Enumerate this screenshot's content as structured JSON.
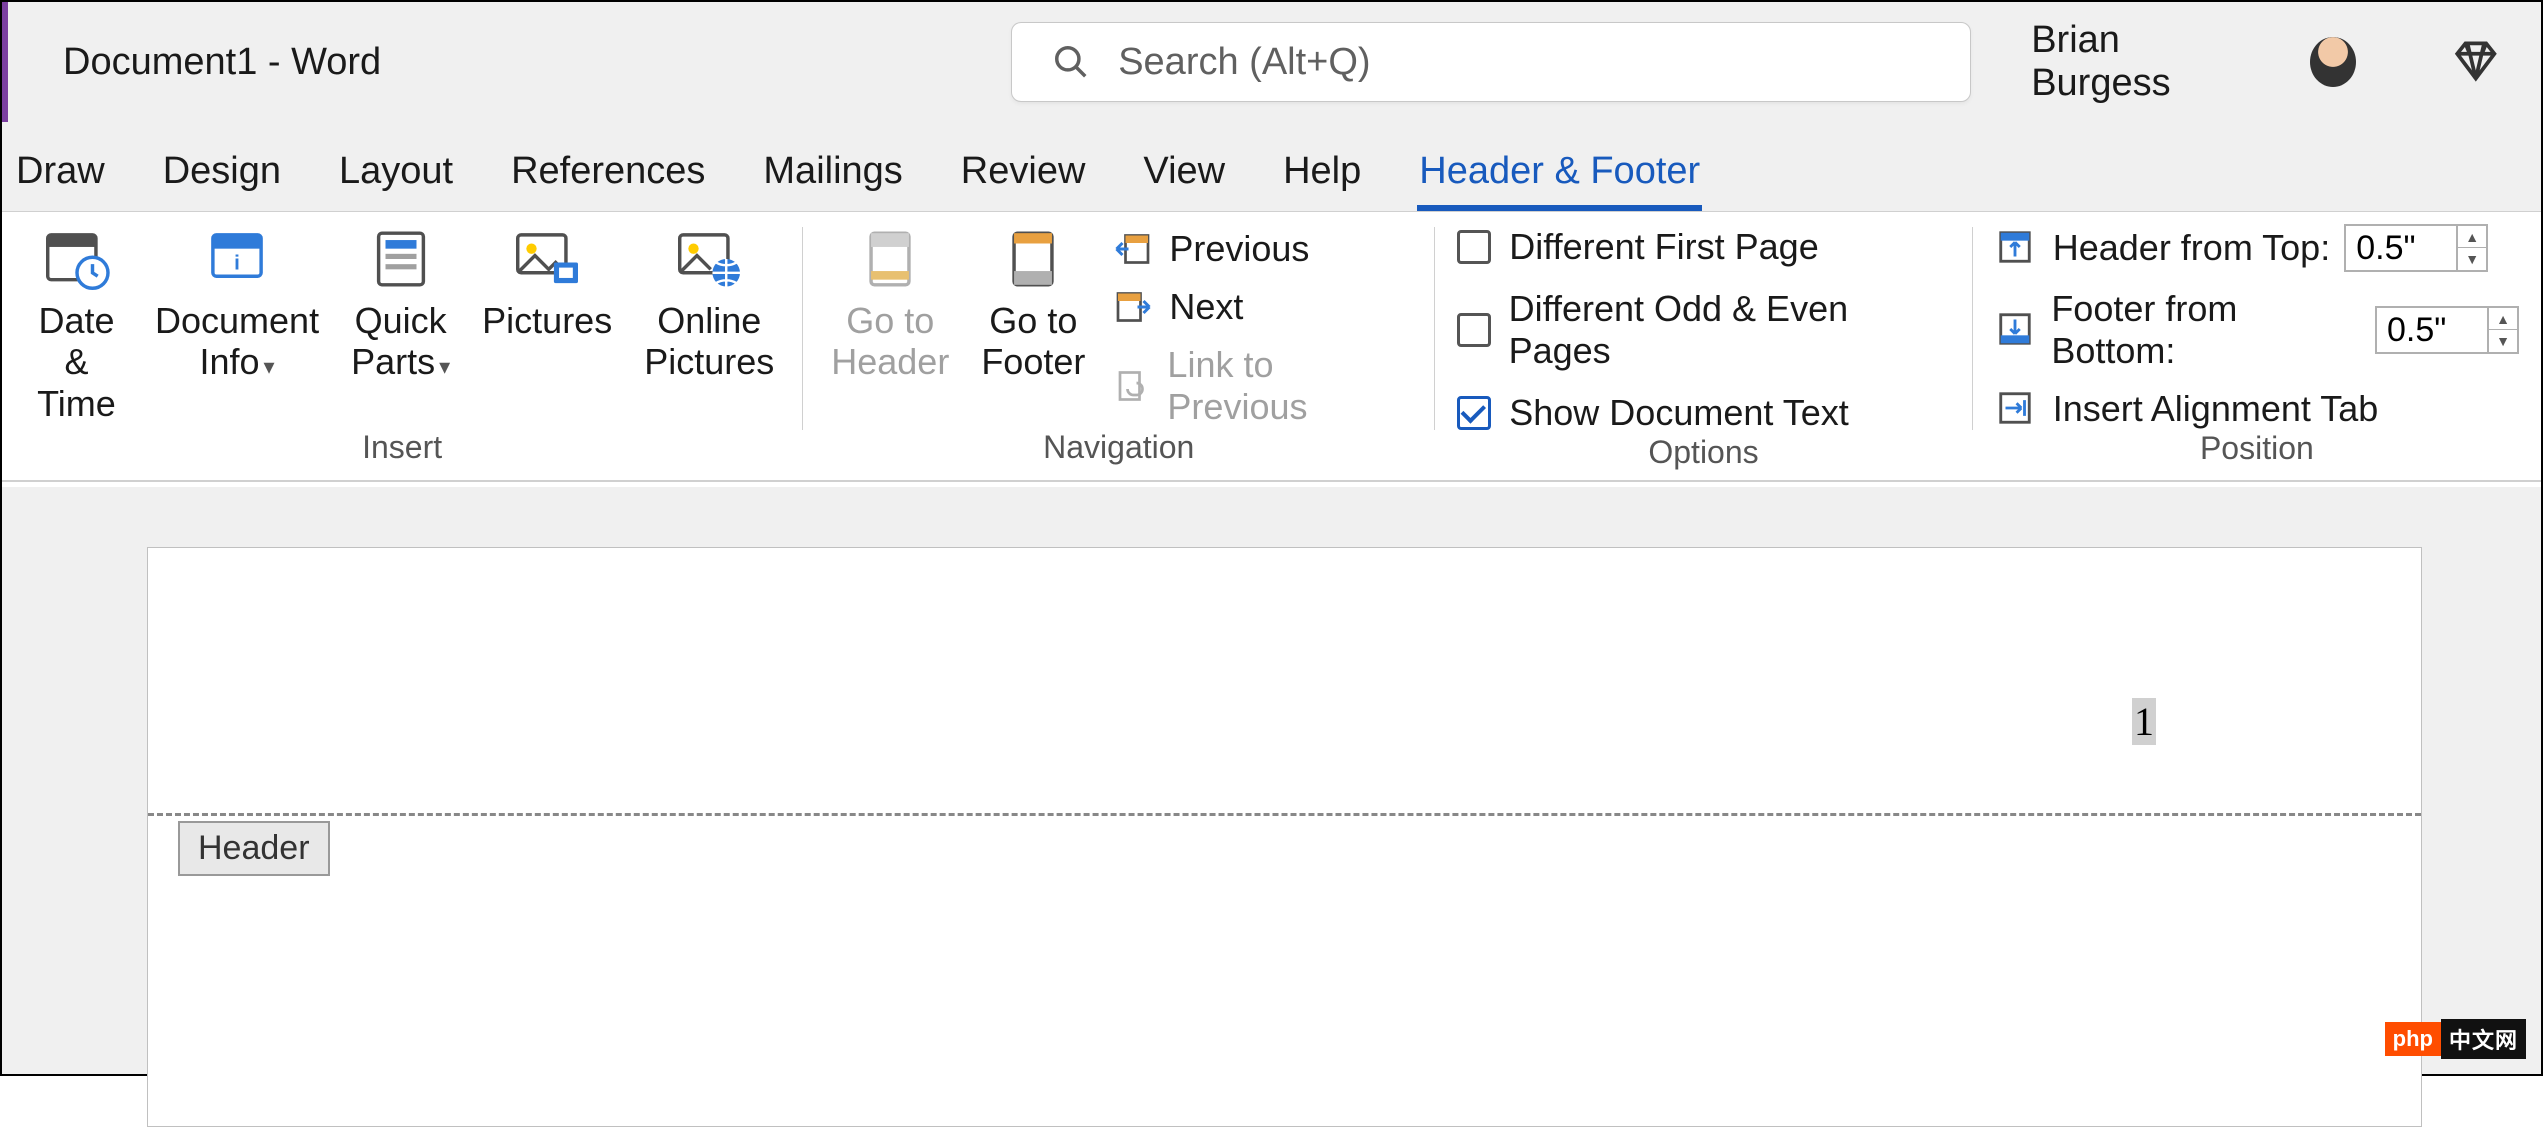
{
  "title": "Document1  -  Word",
  "search": {
    "placeholder": "Search (Alt+Q)"
  },
  "user": {
    "name": "Brian Burgess"
  },
  "tabs": [
    "Draw",
    "Design",
    "Layout",
    "References",
    "Mailings",
    "Review",
    "View",
    "Help",
    "Header & Footer"
  ],
  "active_tab": "Header & Footer",
  "ribbon": {
    "insert": {
      "label": "Insert",
      "date_time": "Date &\nTime",
      "doc_info": "Document\nInfo",
      "quick_parts": "Quick\nParts",
      "pictures": "Pictures",
      "online_pictures": "Online\nPictures"
    },
    "navigation": {
      "label": "Navigation",
      "go_header": "Go to\nHeader",
      "go_footer": "Go to\nFooter",
      "previous": "Previous",
      "next": "Next",
      "link_prev": "Link to Previous"
    },
    "options": {
      "label": "Options",
      "diff_first": "Different First Page",
      "diff_odd_even": "Different Odd & Even Pages",
      "show_doc": "Show Document Text",
      "checked": {
        "diff_first": false,
        "diff_odd_even": false,
        "show_doc": true
      }
    },
    "position": {
      "label": "Position",
      "header_top": "Header from Top:",
      "footer_bottom": "Footer from Bottom:",
      "align_tab": "Insert Alignment Tab",
      "header_val": "0.5\"",
      "footer_val": "0.5\""
    }
  },
  "doc": {
    "header_tag": "Header",
    "page_number": "1"
  },
  "watermark": {
    "a": "php",
    "b": "中文网"
  }
}
